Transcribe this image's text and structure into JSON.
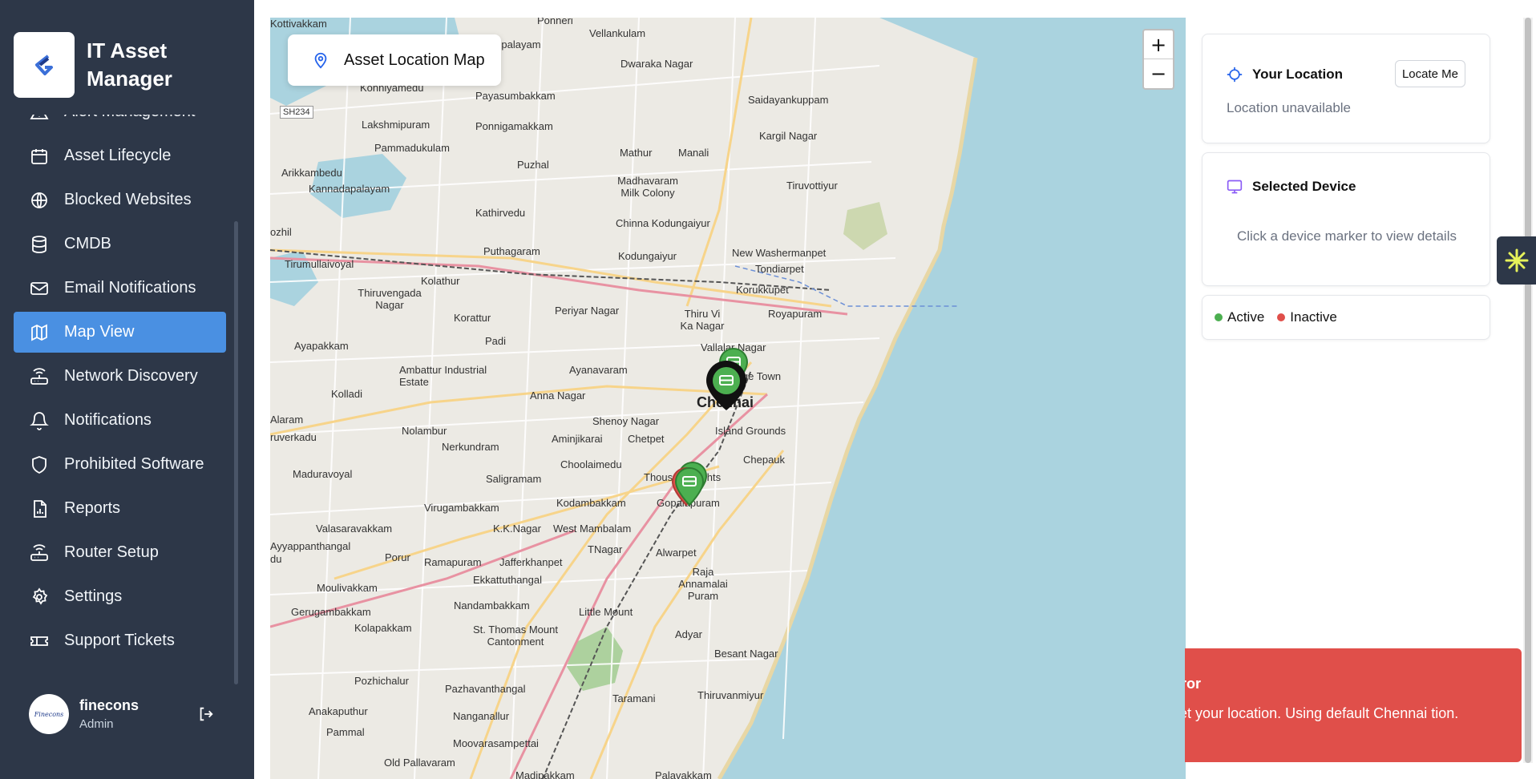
{
  "app": {
    "title": "IT Asset Manager"
  },
  "sidebar": {
    "items": [
      {
        "label": "Alert Management",
        "icon": "alert-triangle-icon"
      },
      {
        "label": "Asset Lifecycle",
        "icon": "calendar-icon"
      },
      {
        "label": "Blocked Websites",
        "icon": "globe-icon"
      },
      {
        "label": "CMDB",
        "icon": "database-icon"
      },
      {
        "label": "Email Notifications",
        "icon": "mail-icon"
      },
      {
        "label": "Map View",
        "icon": "map-icon",
        "active": true
      },
      {
        "label": "Network Discovery",
        "icon": "router-icon"
      },
      {
        "label": "Notifications",
        "icon": "bell-icon"
      },
      {
        "label": "Prohibited Software",
        "icon": "shield-icon"
      },
      {
        "label": "Reports",
        "icon": "file-chart-icon"
      },
      {
        "label": "Router Setup",
        "icon": "router-icon"
      },
      {
        "label": "Settings",
        "icon": "gear-icon"
      },
      {
        "label": "Support Tickets",
        "icon": "ticket-icon"
      }
    ]
  },
  "user": {
    "name": "finecons",
    "role": "Admin",
    "avatar_text": "Finecons"
  },
  "map": {
    "title": "Asset Location Map",
    "zoom_in": "+",
    "zoom_out": "−",
    "places": [
      "Ponneri",
      "Vellankulam",
      "Kannampalayam",
      "Dwaraka Nagar",
      "Konniyamedu",
      "Payasumbakkam",
      "Saidayankuppam",
      "SH234",
      "Lakshmipuram",
      "Ponnigamakkam",
      "Pammadukulam",
      "Kargil Nagar",
      "Puzhal",
      "Mathur",
      "Manali",
      "Arikkambedu",
      "Kannadapalayam",
      "Madhavaram Milk Colony",
      "Tiruvottiyur",
      "Kathirvedu",
      "Chinna Kodungaiyur",
      "Puthagaram",
      "Kodungaiyur",
      "New Washermanpet",
      "Tondiarpet",
      "Tirumullaivoyal",
      "Kolathur",
      "Korukkupet",
      "Thiruvengada Nagar",
      "Korattur",
      "Periyar Nagar",
      "Thiru Vi Ka Nagar",
      "Royapuram",
      "Padi",
      "Vallalar Nagar",
      "Ayapakkam",
      "Ambattur Industrial Estate",
      "Ayanavaram",
      "George Town",
      "Anna Nagar",
      "Kolladi",
      "Chennai",
      "Shenoy Nagar",
      "Island Grounds",
      "Nolambur",
      "Aminjikarai",
      "Chetpet",
      "ruverkadu",
      "Nerkundram",
      "Chepauk",
      "Maduravoyal",
      "Choolaimedu",
      "Saligramam",
      "Thousand Lights",
      "Kodambakkam",
      "Gopalapuram",
      "Virugambakkam",
      "Valasaravakkam",
      "K.K.Nagar",
      "West Mambalam",
      "Ayyappanthangal",
      "Porur",
      "TNagar",
      "Alwarpet",
      "Ramapuram",
      "Jafferkhanpet",
      "Raja Annamalai Puram",
      "Moulivakkam",
      "Ekkattuthangal",
      "Gerugambakkam",
      "Nandambakkam",
      "Little Mount",
      "Kolapakkam",
      "St. Thomas Mount Cantonment",
      "Adyar",
      "Besant Nagar",
      "Pozhichalur",
      "Pazhavanthangal",
      "Thiruvanmiyur",
      "Taramani",
      "Anakaputhur",
      "Nanganallur",
      "Pammal",
      "Moovarasampettai",
      "Kottivakkam",
      "Old Pallavaram",
      "Madipakkam",
      "Palavakkam",
      "Alaram",
      "ozhil",
      "du"
    ]
  },
  "location_card": {
    "title": "Your Location",
    "button": "Locate Me",
    "status": "Location unavailable"
  },
  "device_card": {
    "title": "Selected Device",
    "hint": "Click a device marker to view details"
  },
  "legend": {
    "active": "Active",
    "inactive": "Inactive",
    "active_color": "#4caf50",
    "inactive_color": "#e04f4a"
  },
  "toast": {
    "title": "tion Error",
    "message": "d not get your location. Using default Chennai tion.",
    "color": "#e04f4a"
  }
}
